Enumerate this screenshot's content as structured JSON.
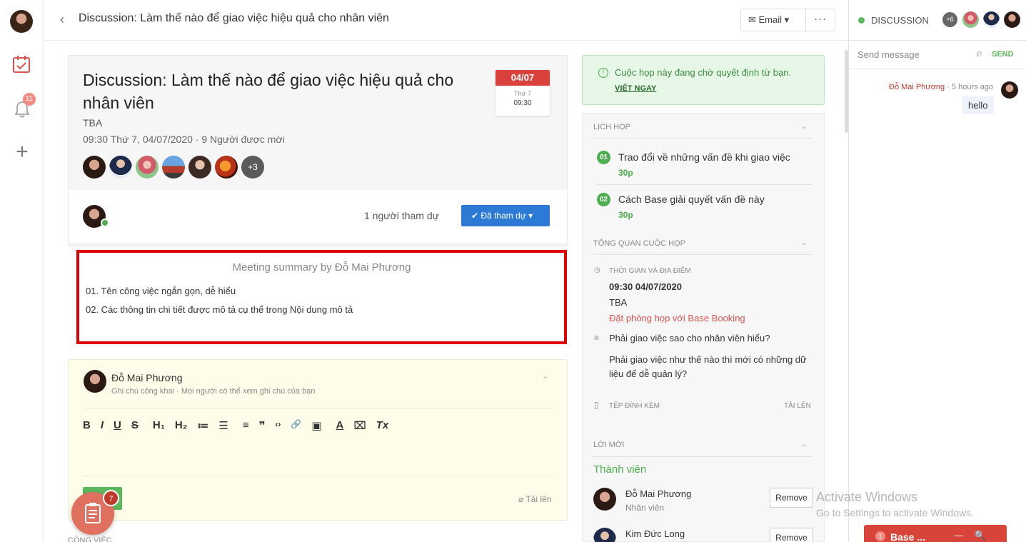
{
  "header": {
    "back_icon": "chevron-left-icon",
    "title": "Discussion: Làm thế nào để giao việc hiệu quả cho nhân viên",
    "email_label": "Email",
    "more_label": "···"
  },
  "rail": {
    "notification_count": "11"
  },
  "meeting": {
    "title": "Discussion: Làm thế nào để giao việc hiệu quả cho nhân viên",
    "location": "TBA",
    "when": "09:30 Thứ 7, 04/07/2020 · 9 Người được mời",
    "extra_invitees": "+3",
    "date": "04/07",
    "weekday": "Thứ 7",
    "time": "09:30",
    "attend_count": "1 người tham dự",
    "attend_button": "✔ Đã tham dự ▾"
  },
  "summary": {
    "title": "Meeting summary by Đỗ Mai Phương",
    "items": [
      "01.  Tên công việc ngắn gọn, dễ hiểu",
      "02.  Các thông tin chi tiết được mô tả cụ thể trong Nội dung mô tả"
    ]
  },
  "note": {
    "author": "Đỗ Mai Phương",
    "desc": "Ghi chú công khai · Mọi người có thể xem ghi chú của bạn",
    "upload": "Tải lên",
    "toolbar": [
      "B",
      "I",
      "U",
      "S",
      "H₁",
      "H₂",
      "≔",
      "☰",
      "≡",
      "❞",
      "‹›",
      "🔗",
      "▣",
      "A",
      "⌧",
      "Tx"
    ]
  },
  "fab": {
    "count": "7",
    "label_below": "CÔNG VIỆC"
  },
  "alert": {
    "message": "Cuộc họp này đang chờ quyết định từ bạn.",
    "action": "VIẾT NGAY"
  },
  "panel": {
    "agenda_header": "LỊCH HỌP",
    "agenda": [
      {
        "num": "01",
        "title": "Trao đổi về những vấn đề khi giao việc",
        "duration": "30p"
      },
      {
        "num": "02",
        "title": "Cách Base giải quyết vấn đề này",
        "duration": "30p"
      }
    ],
    "overview_header": "TỔNG QUAN CUỘC HỌP",
    "time_place_label": "THỜI GIAN VÀ ĐỊA ĐIỂM",
    "datetime": "09:30 04/07/2020",
    "location": "TBA",
    "booking_link": "Đặt phòng họp với Base Booking",
    "question1": "Phải giao việc sao cho nhân viên hiểu?",
    "question2_line1": "Phải giao việc như thế nào thì mới có những dữ",
    "question2_line2": "liệu để dễ quản lý?",
    "attach_label": "TỆP ĐÍNH KÈM",
    "upload_label": "TẢI LÊN",
    "invite_header": "LỜI MỜI",
    "members_header": "Thành viên",
    "members": [
      {
        "name": "Đỗ Mai Phương",
        "role": "Nhân viên",
        "action": "Remove"
      },
      {
        "name": "Kim Đức Long",
        "role": "",
        "action": "Remove"
      }
    ]
  },
  "discussion": {
    "title": "DISCUSSION",
    "extra_participants": "+6",
    "input_placeholder": "Send message",
    "send_label": "SEND",
    "message_author": "Đỗ Mai Phương",
    "message_time": " · 5 hours ago",
    "message_text": "hello"
  },
  "os": {
    "activate_title": "Activate Windows",
    "activate_sub": "Go to Settings to activate Windows.",
    "base_count": "1",
    "base_label": "Base ...",
    "base_icons": "— 🔍 ⤢"
  },
  "colors": {
    "accent_blue": "#2d7ad6",
    "success_green": "#4cae4c",
    "danger_red": "#d9413c",
    "highlight_border": "#e00000"
  }
}
